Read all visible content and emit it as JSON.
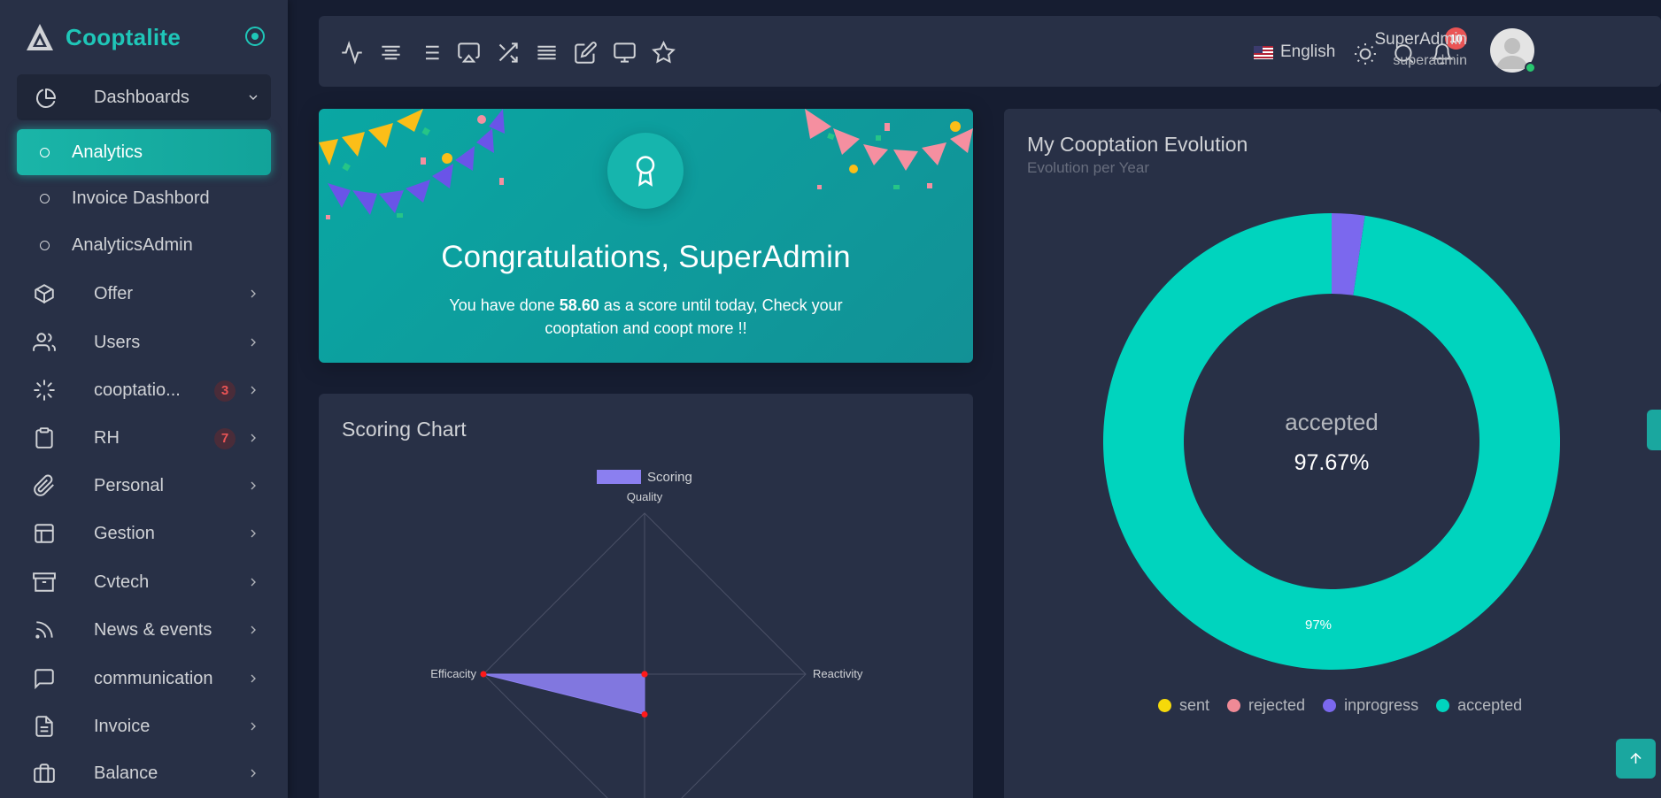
{
  "brand": {
    "name": "Cooptalite"
  },
  "sidebar": {
    "group_label": "Dashboards",
    "sub_items": [
      {
        "label": "Analytics",
        "active": true
      },
      {
        "label": "Invoice Dashbord",
        "active": false
      },
      {
        "label": "AnalyticsAdmin",
        "active": false
      }
    ],
    "items": [
      {
        "label": "Offer",
        "icon": "box-icon",
        "badge": ""
      },
      {
        "label": "Users",
        "icon": "users-icon",
        "badge": ""
      },
      {
        "label": "cooptatio...",
        "icon": "loader-icon",
        "badge": "3"
      },
      {
        "label": "RH",
        "icon": "clipboard-icon",
        "badge": "7"
      },
      {
        "label": "Personal",
        "icon": "paperclip-icon",
        "badge": ""
      },
      {
        "label": "Gestion",
        "icon": "layout-icon",
        "badge": ""
      },
      {
        "label": "Cvtech",
        "icon": "archive-icon",
        "badge": ""
      },
      {
        "label": "News & events",
        "icon": "rss-icon",
        "badge": ""
      },
      {
        "label": "communication",
        "icon": "message-square-icon",
        "badge": ""
      },
      {
        "label": "Invoice",
        "icon": "file-text-icon",
        "badge": ""
      },
      {
        "label": "Balance",
        "icon": "briefcase-icon",
        "badge": ""
      }
    ]
  },
  "navbar": {
    "language": "English",
    "notifications_count": "10",
    "user": {
      "name": "SuperAdmin",
      "role": "superadmin"
    }
  },
  "congrats": {
    "title": "Congratulations, SuperAdmin",
    "text_before": "You have done ",
    "score": "58.60",
    "text_after": " as a score until today, Check your cooptation and coopt more !!"
  },
  "scoring": {
    "title": "Scoring Chart"
  },
  "evolution": {
    "title": "My Cooptation Evolution",
    "subtitle": "Evolution per Year",
    "center_label": "accepted",
    "center_value": "97.67%",
    "slice_label": "97%",
    "legend": [
      {
        "label": "sent",
        "color": "#f5d90a"
      },
      {
        "label": "rejected",
        "color": "#f08a96"
      },
      {
        "label": "inprogress",
        "color": "#7b68ee"
      },
      {
        "label": "accepted",
        "color": "#00d4be"
      }
    ]
  },
  "chart_data": [
    {
      "type": "radar",
      "title": "Scoring Chart",
      "axes": [
        "Quality",
        "Reactivity",
        "",
        "Efficacity"
      ],
      "series": [
        {
          "name": "Scoring",
          "values": [
            0,
            0,
            0.25,
            1
          ]
        }
      ],
      "color": "#8b7ff0"
    },
    {
      "type": "pie",
      "title": "My Cooptation Evolution",
      "categories": [
        "sent",
        "rejected",
        "inprogress",
        "accepted"
      ],
      "values": [
        0,
        0,
        2.33,
        97.67
      ],
      "colors": [
        "#f5d90a",
        "#f08a96",
        "#7b68ee",
        "#00d4be"
      ]
    }
  ]
}
